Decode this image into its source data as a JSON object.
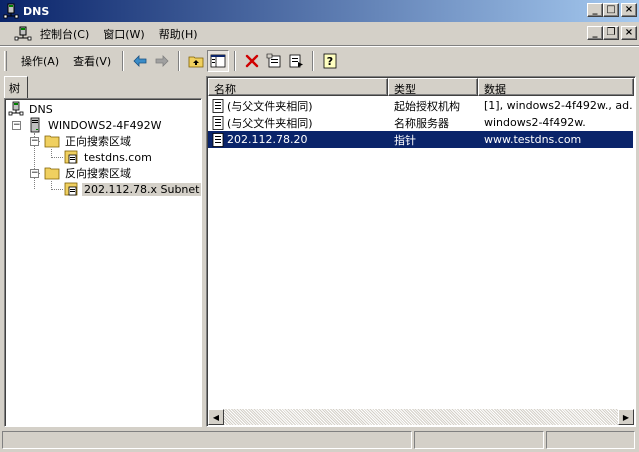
{
  "window": {
    "title": "DNS",
    "controls": {
      "minimize": "_",
      "maximize": "□",
      "close": "×"
    }
  },
  "menubar": {
    "items": [
      "控制台(C)",
      "窗口(W)",
      "帮助(H)"
    ],
    "inner_controls": {
      "minimize": "_",
      "restore": "❐",
      "close": "×"
    }
  },
  "toolbar": {
    "menus": [
      "操作(A)",
      "查看(V)"
    ],
    "buttons": [
      "back-arrow-icon",
      "forward-arrow-icon",
      "up-folder-icon",
      "show-hide-tree-icon",
      "delete-icon",
      "properties-icon",
      "export-list-icon",
      "help-icon"
    ]
  },
  "tree": {
    "tab_label": "树",
    "nodes": {
      "root": "DNS",
      "server": "WINDOWS2-4F492W",
      "forward_zones": "正向搜索区域",
      "forward_zone_item": "testdns.com",
      "reverse_zones": "反向搜索区域",
      "reverse_zone_item": "202.112.78.x Subnet"
    }
  },
  "list": {
    "columns": [
      "名称",
      "类型",
      "数据"
    ],
    "rows": [
      {
        "name": "(与父文件夹相同)",
        "type": "起始授权机构",
        "data": "[1], windows2-4f492w., ad..."
      },
      {
        "name": "(与父文件夹相同)",
        "type": "名称服务器",
        "data": "windows2-4f492w."
      },
      {
        "name": "202.112.78.20",
        "type": "指针",
        "data": "www.testdns.com"
      }
    ],
    "selected_row": 2
  },
  "colors": {
    "title_bar": "#0a246a",
    "selection": "#0a246a",
    "face": "#d4d0c8"
  }
}
